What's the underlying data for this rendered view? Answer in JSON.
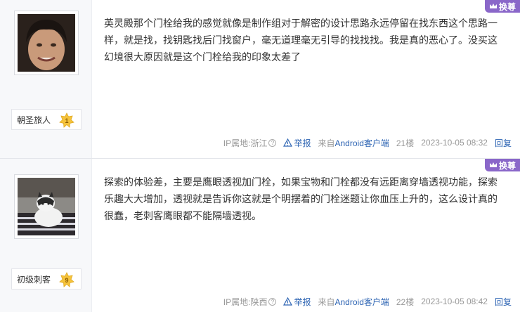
{
  "posts": [
    {
      "username": "朝圣旅人",
      "level": "1",
      "level_color": "#f5c33b",
      "content": "英灵殿那个门栓给我的感觉就像是制作组对于解密的设计思路永远停留在找东西这个思路一样，就是找，找钥匙找后门找窗户，毫无道理毫无引导的找找找。我是真的恶心了。没买这幻境很大原因就是这个门栓给我的印象太差了",
      "ip": "IP属地:浙江",
      "report": "举报",
      "source_prefix": "来自",
      "source_link": "Android客户端",
      "floor": "21楼",
      "time": "2023-10-05 08:32",
      "reply": "回复",
      "swap": "换尊"
    },
    {
      "username": "初级刺客",
      "level": "9",
      "level_color": "#f5c33b",
      "content": "探索的体验差，主要是鹰眼透视加门栓，如果宝物和门栓都没有远距离穿墙透视功能，探索乐趣大大增加，透视就是告诉你这就是个明摆着的门栓迷题让你血压上升的，这么设计真的很蠢，老刺客鹰眼都不能隔墙透视。",
      "ip": "IP属地:陕西",
      "report": "举报",
      "source_prefix": "来自",
      "source_link": "Android客户端",
      "floor": "22楼",
      "time": "2023-10-05 08:42",
      "reply": "回复",
      "swap": "换尊"
    }
  ]
}
